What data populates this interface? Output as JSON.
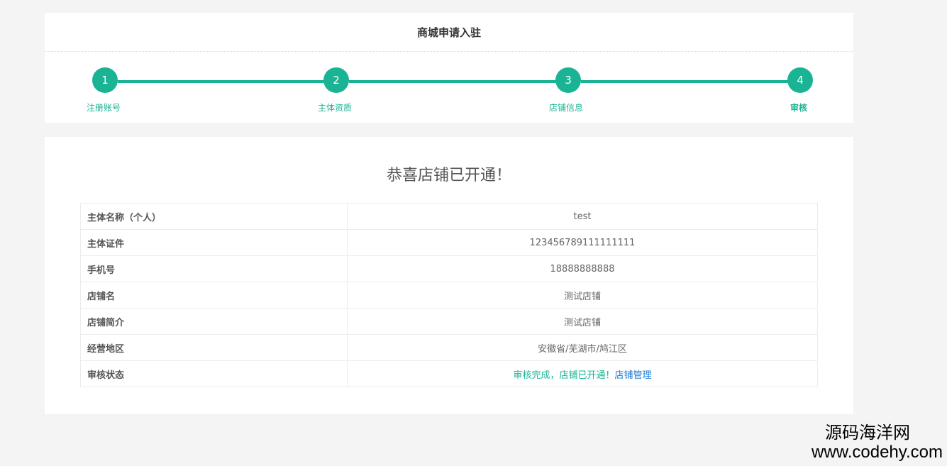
{
  "header": {
    "title": "商城申请入驻"
  },
  "steps": [
    {
      "number": "1",
      "label": "注册账号"
    },
    {
      "number": "2",
      "label": "主体资质"
    },
    {
      "number": "3",
      "label": "店铺信息"
    },
    {
      "number": "4",
      "label": "审核"
    }
  ],
  "progress": {
    "current_step": 4,
    "total_steps": 4
  },
  "main": {
    "heading": "恭喜店铺已开通！",
    "rows": [
      {
        "label": "主体名称（个人）",
        "value": "test"
      },
      {
        "label": "主体证件",
        "value": "123456789111111111"
      },
      {
        "label": "手机号",
        "value": "18888888888"
      },
      {
        "label": "店铺名",
        "value": "测试店铺"
      },
      {
        "label": "店铺简介",
        "value": "测试店铺"
      },
      {
        "label": "经营地区",
        "value": "安徽省/芜湖市/鸠江区"
      }
    ],
    "status": {
      "label": "审核状态",
      "text": "审核完成，店铺已开通！",
      "link": "店铺管理"
    }
  },
  "watermark": {
    "cn": "源码海洋网",
    "url": "www.codehy.com"
  },
  "colors": {
    "accent": "#1ab394",
    "link": "#1a7bd4",
    "background": "#f4f4f4"
  }
}
